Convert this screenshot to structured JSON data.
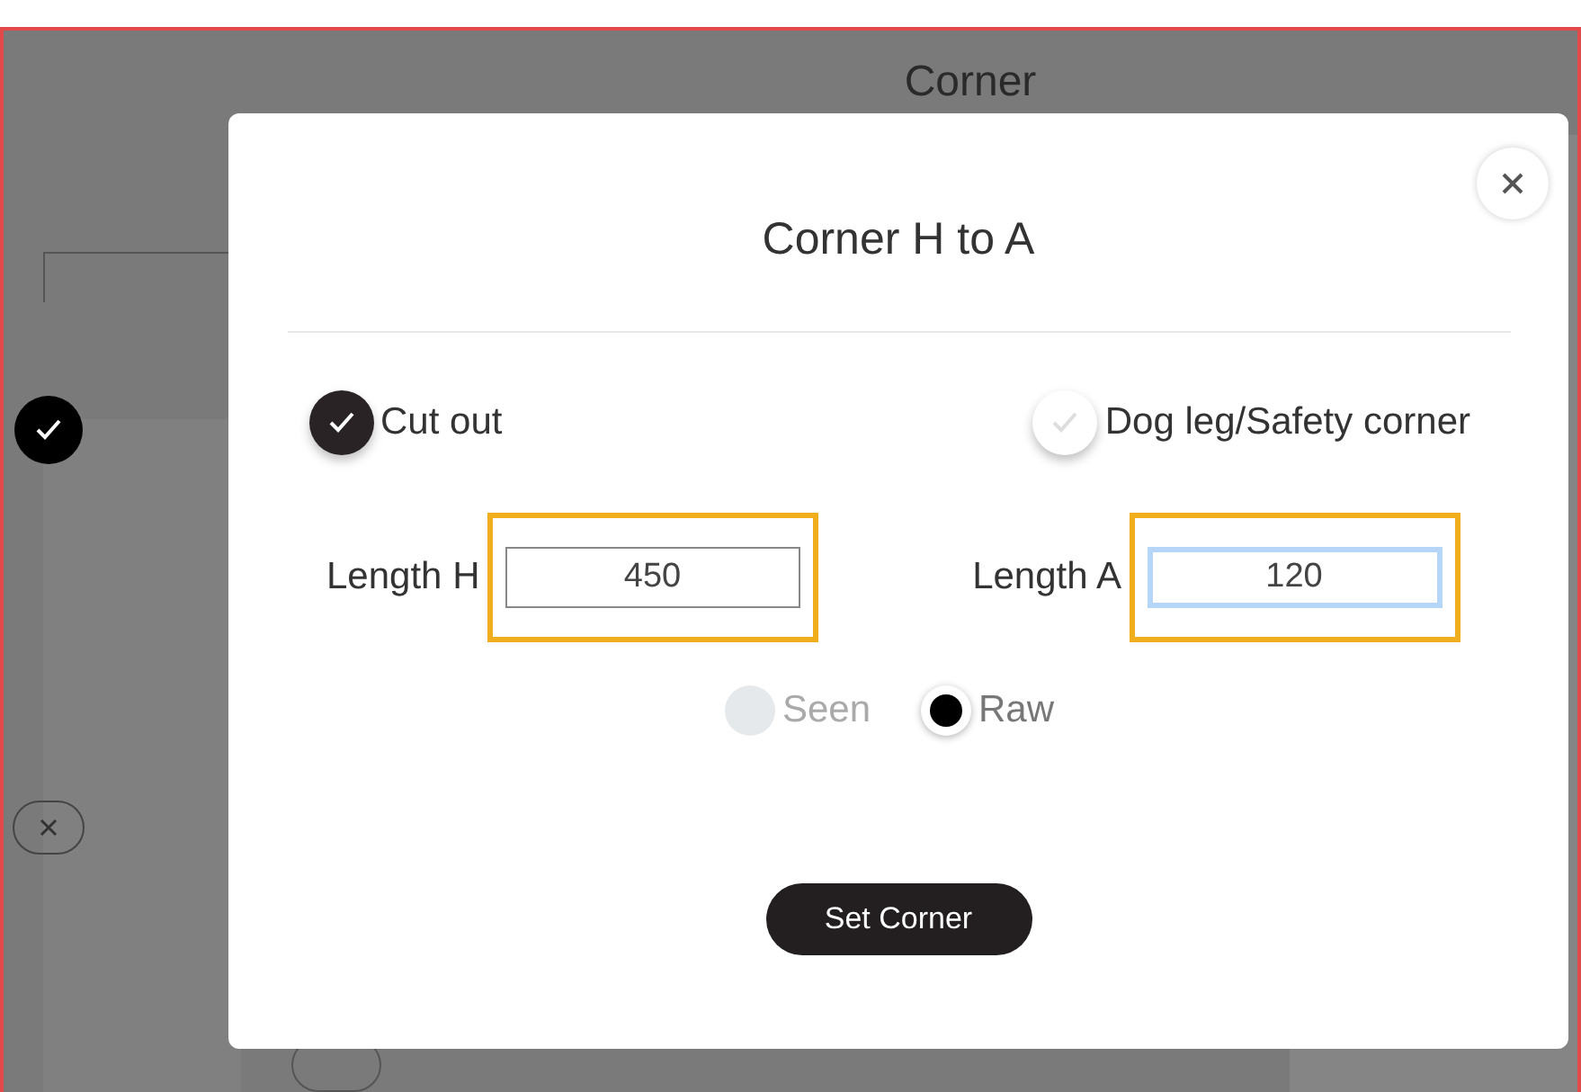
{
  "page": {
    "title": "Corner"
  },
  "background_controls": [
    {
      "kind": "check",
      "checked": true
    },
    {
      "kind": "remove"
    }
  ],
  "dialog": {
    "title": "Corner H to A",
    "options": [
      {
        "label": "Cut out",
        "checked": true
      },
      {
        "label": "Dog leg/Safety corner",
        "checked": false
      }
    ],
    "fields": [
      {
        "label": "Length H",
        "value": "450",
        "highlighted": true,
        "focused": false
      },
      {
        "label": "Length A",
        "value": "120",
        "highlighted": true,
        "focused": true
      }
    ],
    "measure": [
      {
        "label": "Seen",
        "selected": false,
        "disabled": true
      },
      {
        "label": "Raw",
        "selected": true,
        "disabled": false
      }
    ],
    "submit": "Set Corner"
  }
}
